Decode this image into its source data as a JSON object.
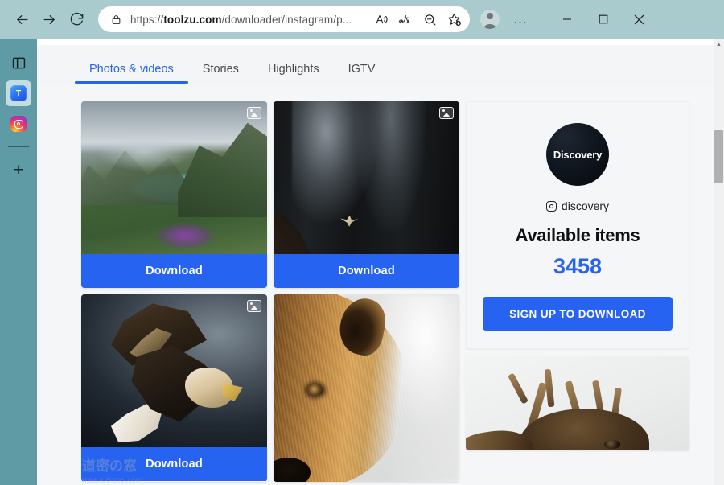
{
  "browser": {
    "back_label": "Back",
    "forward_label": "Forward",
    "reload_label": "Refresh",
    "url_prefix": "https://",
    "url_domain": "toolzu.com",
    "url_path": "/downloader/instagram/p...",
    "url_full": "https://toolzu.com/downloader/instagram/p...",
    "icons": {
      "lock": "lock-icon",
      "read_aloud": "read-aloud-icon",
      "translate": "translate-icon",
      "zoom_out": "zoom-out-icon",
      "favorites": "add-favorite-icon",
      "profile": "profile-avatar-icon",
      "settings": "more-settings-icon"
    },
    "window_controls": {
      "minimize": "–",
      "maximize": "☐",
      "close": "✕"
    },
    "read_aloud_glyph": "A",
    "translate_glyph": "aあ",
    "more_glyph": "…"
  },
  "sidebar": {
    "items": [
      {
        "name": "split-screen-icon",
        "label": ""
      },
      {
        "name": "toolzu-tab",
        "label": "T"
      },
      {
        "name": "instagram-tab",
        "label": ""
      }
    ],
    "add_label": "+"
  },
  "tabs": [
    {
      "label": "Photos & videos",
      "active": true
    },
    {
      "label": "Stories",
      "active": false
    },
    {
      "label": "Highlights",
      "active": false
    },
    {
      "label": "IGTV",
      "active": false
    }
  ],
  "gallery": {
    "download_label": "Download",
    "badge_name": "photo-type-badge",
    "cards": [
      {
        "alt": "mountain-lake-landscape",
        "has_download": true,
        "has_badge": true
      },
      {
        "alt": "waterfall-dark",
        "has_download": true,
        "has_badge": true
      },
      {
        "alt": "bald-eagle-flight",
        "has_download": true,
        "has_badge": true
      },
      {
        "alt": "brown-bear-closeup",
        "has_download": false,
        "has_badge": false
      }
    ]
  },
  "panel": {
    "avatar_text": "Discovery",
    "handle": "discovery",
    "available_items_label": "Available items",
    "available_items_count": "3458",
    "signup_label": "SIGN UP TO DOWNLOAD",
    "deer_alt": "deer-antlers-photo"
  },
  "watermark": {
    "logo_text": "道密の窓",
    "url_text": "www.ruanmei.com"
  },
  "colors": {
    "accent_blue": "#2563f0",
    "browser_chrome": "#a9cbcd",
    "sidebar": "#5f9ba4",
    "page_bg": "#f4f5f7"
  },
  "scrollbar": {
    "up_glyph": "▲",
    "down_glyph": "▼"
  }
}
